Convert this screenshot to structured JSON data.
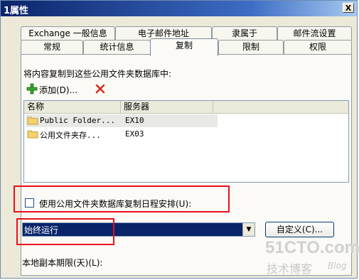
{
  "window": {
    "title": "1属性",
    "close_label": "X"
  },
  "tabs_row1": [
    "Exchange 一般信息",
    "电子邮件地址",
    "隶属于",
    "邮件流设置"
  ],
  "tabs_row2": [
    "常规",
    "统计信息",
    "复制",
    "限制",
    "权限"
  ],
  "active_tab": "复制",
  "replicate_label": "将内容复制到这些公用文件夹数据库中:",
  "toolbar": {
    "add_label": "添加(D)...",
    "add_icon": "plus-icon",
    "remove_icon": "delete-x-icon"
  },
  "list": {
    "columns": [
      "名称",
      "服务器"
    ],
    "rows": [
      {
        "name": "Public Folder...",
        "server": "EX10",
        "selected": true
      },
      {
        "name": "公用文件夹存...",
        "server": "EX03",
        "selected": false
      }
    ]
  },
  "schedule_checkbox": {
    "label": "使用公用文件夹数据库复制日程安排(U):",
    "checked": false
  },
  "schedule_combo": {
    "value": "始终运行"
  },
  "customize_button": "自定义(C)...",
  "local_age_label": "本地副本期限(天)(L):",
  "watermark": {
    "line1": "51CTO.com",
    "line2": "技术博客",
    "line3": "Blog"
  },
  "colors": {
    "highlight": "#e8101c",
    "selection": "#0a246a"
  }
}
